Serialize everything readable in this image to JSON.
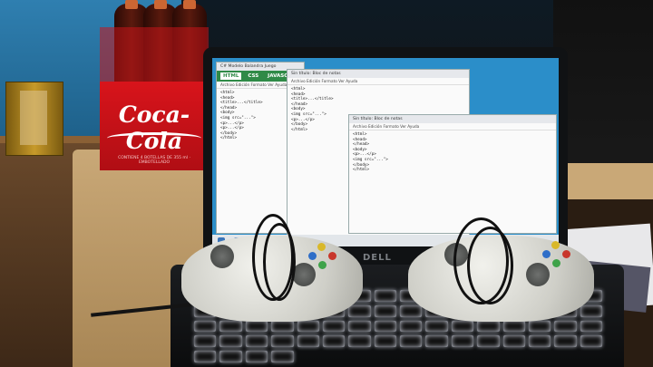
{
  "scene": {
    "box_brand": "Coca-Cola",
    "box_fineprint": "CONTIENE 4 BOTELLAS DE 355 ml · EMBOTELLADO",
    "laptop_logo": "DELL",
    "colors": {
      "wall_blue": "#2b7fb2",
      "coke_red": "#d8141b",
      "key_backlight": "#eef1ff",
      "desk_wood": "#c9a877"
    }
  },
  "screen": {
    "editor": {
      "title": "C# Modelo Balandra Juego",
      "tabs": [
        "HTML",
        "CSS",
        "JAVASCRIPT"
      ],
      "menu": "Archivo  Edición  Formato  Ver  Ayuda"
    },
    "notepad_center": {
      "title": "Sin título: Bloc de notas",
      "menu": "Archivo  Edición  Formato  Ver  Ayuda"
    },
    "notepad_right": {
      "title": "Sin título: Bloc de notas",
      "menu": "Archivo  Edición  Formato  Ver  Ayuda"
    }
  }
}
